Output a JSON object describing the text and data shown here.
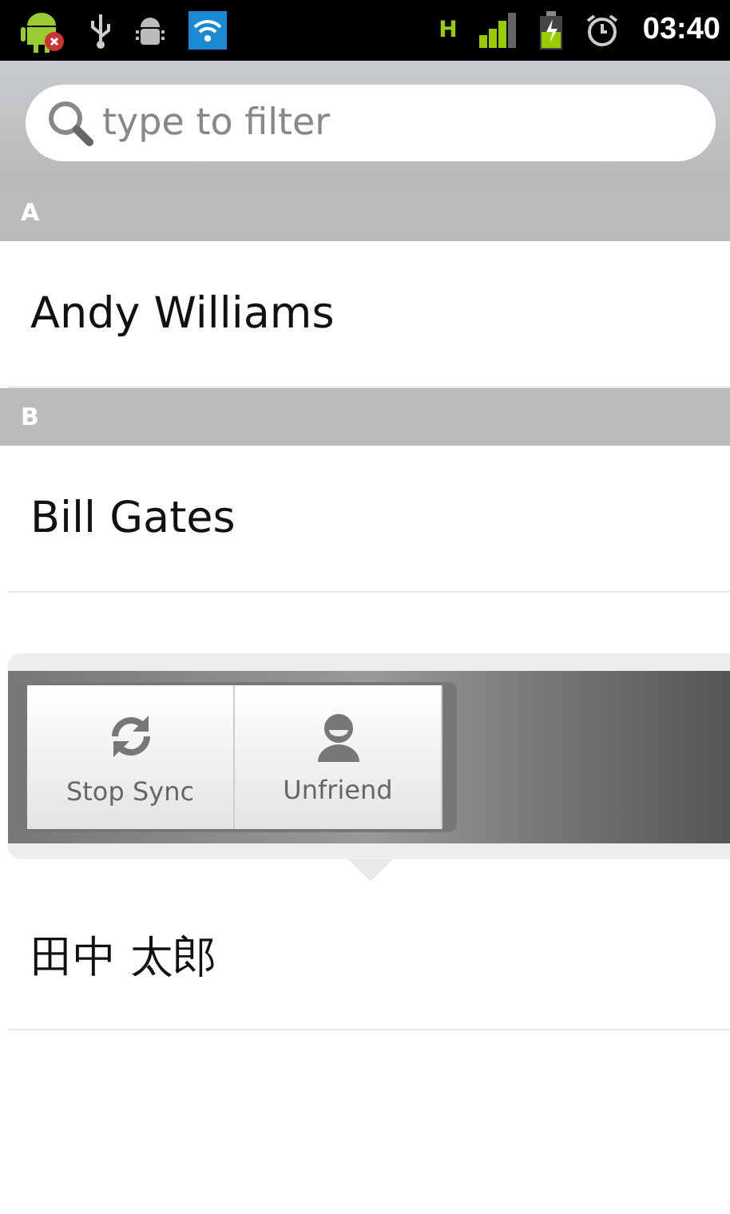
{
  "status_bar": {
    "time": "03:40",
    "network": "H"
  },
  "search": {
    "placeholder": "type to filter"
  },
  "sections": [
    {
      "letter": "A",
      "contacts": [
        {
          "name": "Andy Williams"
        }
      ]
    },
    {
      "letter": "B",
      "contacts": [
        {
          "name": "Bill Gates"
        }
      ]
    }
  ],
  "context_popup": {
    "actions": [
      {
        "label": "Stop Sync",
        "kind": "sync"
      },
      {
        "label": "Unfriend",
        "kind": "person"
      }
    ]
  },
  "contacts_after": [
    {
      "name": "田中 太郎"
    }
  ]
}
